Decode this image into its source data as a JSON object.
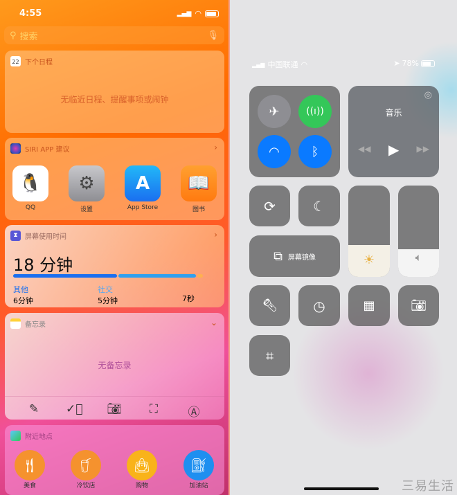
{
  "left": {
    "status": {
      "time": "4:55"
    },
    "search": {
      "placeholder": "搜索"
    },
    "calendar": {
      "icon_day": "22",
      "title": "下个日程",
      "empty": "无临近日程、提醒事项或闹钟"
    },
    "siri": {
      "title": "SIRI APP 建议",
      "apps": [
        {
          "label": "QQ",
          "icon": "qq-icon"
        },
        {
          "label": "设置",
          "icon": "settings-icon"
        },
        {
          "label": "App Store",
          "icon": "app-store-icon"
        },
        {
          "label": "图书",
          "icon": "books-icon"
        }
      ]
    },
    "screen_time": {
      "title": "屏幕使用时间",
      "total": "18 分钟",
      "usage_fractions": [
        0.51,
        0.38,
        0.03
      ],
      "categories": [
        {
          "name": "其他",
          "value": "6分钟"
        },
        {
          "name": "社交",
          "value": "5分钟"
        },
        {
          "name": "",
          "value": "7秒"
        }
      ],
      "colors": [
        "#1a6ff0",
        "#2fa0f0",
        "#ffb050"
      ]
    },
    "notes": {
      "title": "备忘录",
      "empty": "无备忘录",
      "tools": [
        "compose-icon",
        "checklist-icon",
        "camera-icon",
        "scan-icon",
        "markup-icon"
      ]
    },
    "nearby": {
      "title": "附近地点",
      "places": [
        {
          "label": "美食",
          "color": "#f5922e"
        },
        {
          "label": "冷饮店",
          "color": "#f5922e"
        },
        {
          "label": "购物",
          "color": "#f9b31a"
        },
        {
          "label": "加油站",
          "color": "#1e8ff0"
        }
      ]
    }
  },
  "right": {
    "status": {
      "carrier": "中国联通",
      "battery": "78%"
    },
    "connectivity": {
      "airplane": false,
      "cellular": true,
      "wifi": true,
      "bluetooth": true,
      "colors": {
        "green": "#34c759",
        "blue": "#0a7aff",
        "off": "#8e8e93"
      }
    },
    "music": {
      "title": "音乐"
    },
    "mirroring": {
      "label": "屏幕镜像"
    },
    "brightness": 0.35,
    "volume": 0.3,
    "watermark": "三易生活"
  }
}
